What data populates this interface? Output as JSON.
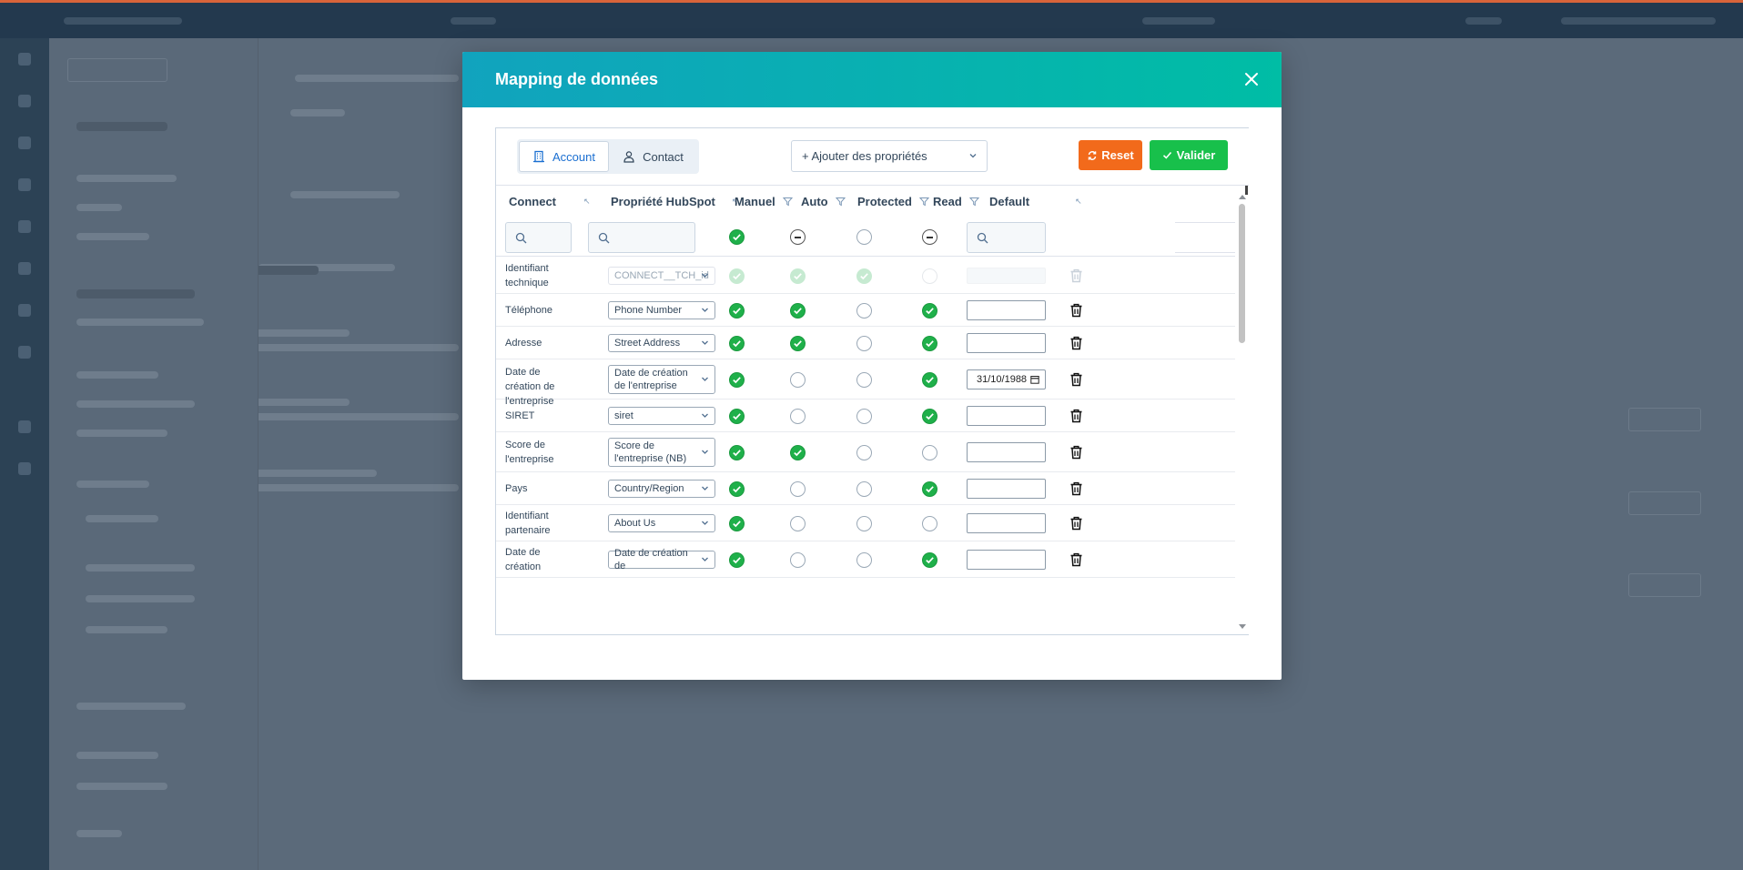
{
  "modal": {
    "title": "Mapping de données",
    "close_icon": "close-icon"
  },
  "toolbar": {
    "tabs": [
      {
        "label": "Account",
        "icon": "building-icon",
        "active": true
      },
      {
        "label": "Contact",
        "icon": "user-icon",
        "active": false
      }
    ],
    "add_properties_label": "+ Ajouter des propriétés",
    "reset_label": "Reset",
    "valider_label": "Valider",
    "colors": {
      "reset": "#f26a1b",
      "valider": "#18c04b",
      "accent": "#1b6fd1",
      "header_start": "#11a3be",
      "header_end": "#00bda5"
    }
  },
  "table": {
    "columns": [
      "Connect",
      "Propriété HubSpot",
      "Manuel",
      "Auto",
      "Protected",
      "Read",
      "Default"
    ],
    "filter_states": {
      "manuel": "checked",
      "auto": "indeterminate",
      "protected": "unchecked",
      "read": "indeterminate"
    },
    "rows": [
      {
        "connect": "Identifiant technique",
        "hubspot": "CONNECT__TCH_id",
        "manuel": true,
        "auto": true,
        "protected": true,
        "read": false,
        "default": "",
        "disabled": true
      },
      {
        "connect": "Téléphone",
        "hubspot": "Phone Number",
        "manuel": true,
        "auto": true,
        "protected": false,
        "read": true,
        "default": ""
      },
      {
        "connect": "Adresse",
        "hubspot": "Street Address",
        "manuel": true,
        "auto": true,
        "protected": false,
        "read": true,
        "default": ""
      },
      {
        "connect": "Date de création de l'entreprise",
        "hubspot": "Date de création de l'entreprise",
        "manuel": true,
        "auto": false,
        "protected": false,
        "read": true,
        "default": "31/10/1988"
      },
      {
        "connect": "SIRET",
        "hubspot": "siret",
        "manuel": true,
        "auto": false,
        "protected": false,
        "read": true,
        "default": ""
      },
      {
        "connect": "Score de l'entreprise",
        "hubspot": "Score de l'entreprise (NB)",
        "manuel": true,
        "auto": true,
        "protected": false,
        "read": false,
        "default": ""
      },
      {
        "connect": "Pays",
        "hubspot": "Country/Region",
        "manuel": true,
        "auto": false,
        "protected": false,
        "read": true,
        "default": ""
      },
      {
        "connect": "Identifiant partenaire",
        "hubspot": "About Us",
        "manuel": true,
        "auto": false,
        "protected": false,
        "read": false,
        "default": ""
      },
      {
        "connect": "Date de création",
        "hubspot": "Date de création de",
        "manuel": true,
        "auto": false,
        "protected": false,
        "read": true,
        "default": ""
      }
    ]
  }
}
